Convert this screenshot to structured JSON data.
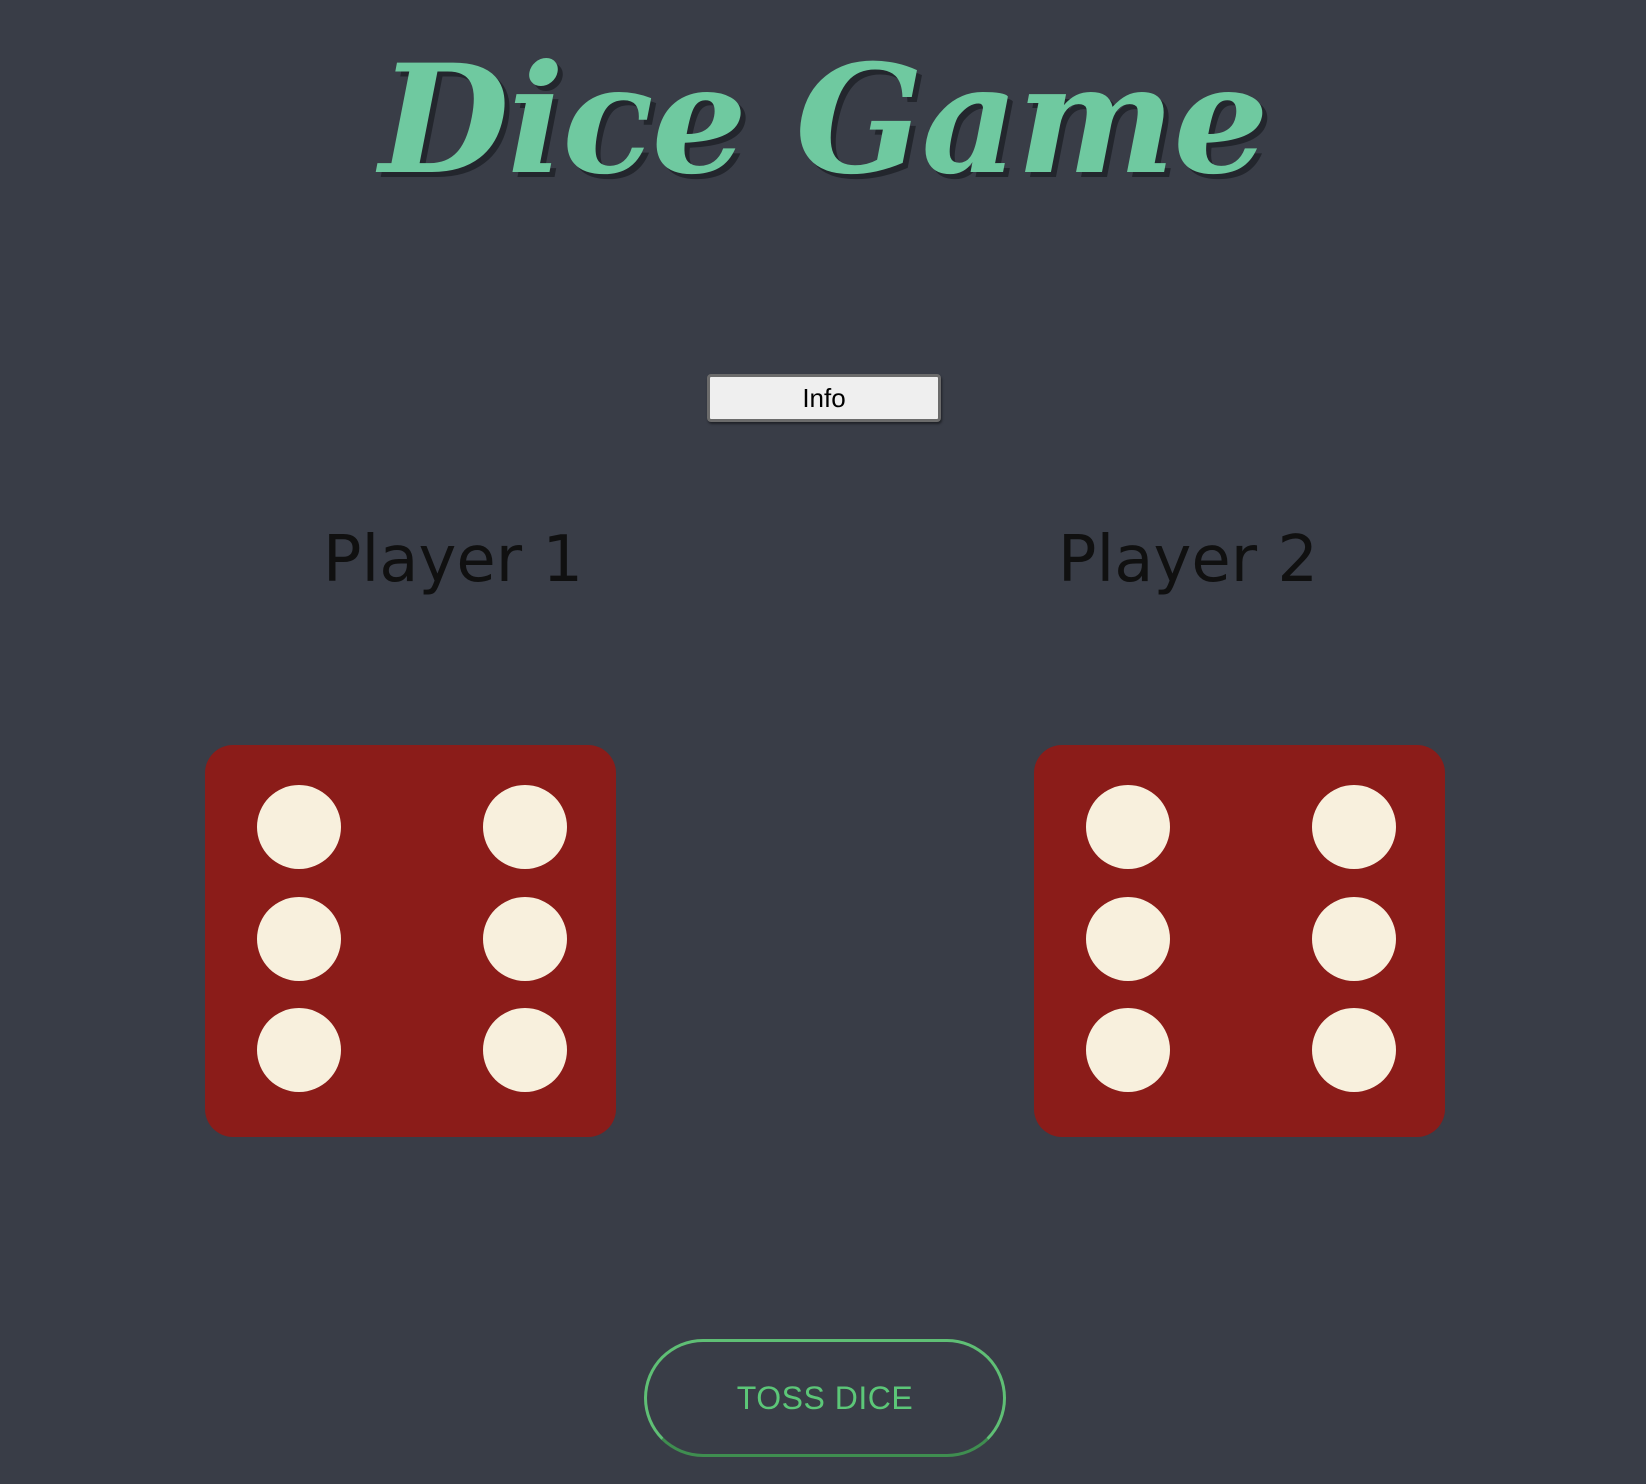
{
  "header": {
    "title": "Dice Game"
  },
  "info_button": {
    "label": "Info"
  },
  "players": [
    {
      "label": "Player 1",
      "die_value": 6
    },
    {
      "label": "Player 2",
      "die_value": 6
    }
  ],
  "toss_button": {
    "label": "TOSS DICE"
  },
  "colors": {
    "background": "#393d47",
    "title": "#6fc9a0",
    "die_face": "#8b1c19",
    "pip": "#f8f0dd",
    "toss_button": "#5cc778"
  }
}
